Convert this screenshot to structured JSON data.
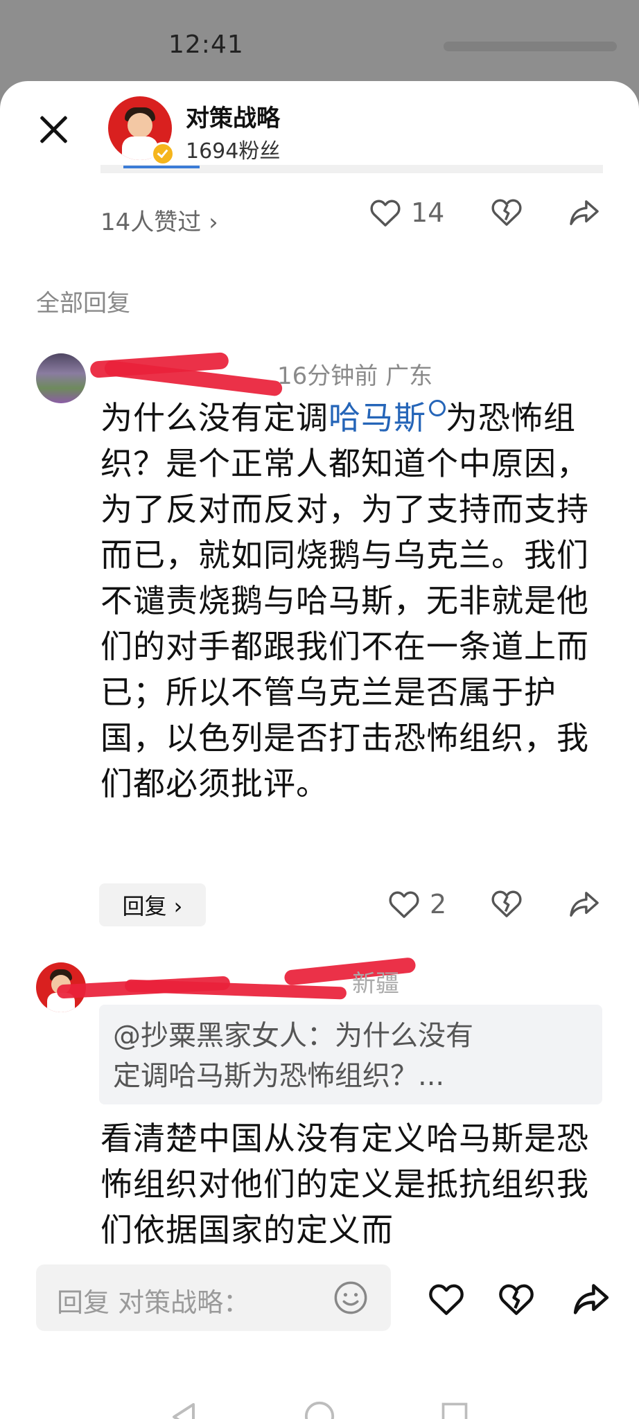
{
  "status_bar": {
    "time": "12:41"
  },
  "post_header": {
    "author_name": "对策战略",
    "fans": "1694粉丝"
  },
  "post_actions": {
    "likes_link": "14人赞过 ›",
    "like_count": "14"
  },
  "section_title": "全部回复",
  "comments": [
    {
      "meta_visible": "16分钟前 广东",
      "text_before": "为什么没有定调",
      "keyword": "哈马斯",
      "text_after": "为恐怖组织？是个正常人都知道个中原因，为了反对而反对，为了支持而支持而已，就如同烧鹅与乌克兰。我们不谴责烧鹅与哈马斯，无非就是他们的对手都跟我们不在一条道上而已；所以不管乌克兰是否属于护国，以色列是否打击恐怖组织，我们都必须批评。",
      "reply_label": "回复 ›",
      "like_count": "2"
    },
    {
      "meta_visible": "新疆",
      "quote_line1": "@抄粟黑家女人：为什么没有",
      "quote_line2": "定调哈马斯为恐怖组织？...",
      "text": "看清楚中国从没有定义哈马斯是恐怖组织对他们的定义是抵抗组织我们依据国家的定义而"
    }
  ],
  "reply_bar": {
    "placeholder": "回复 对策战略："
  },
  "colors": {
    "accent_blue": "#2565b8",
    "redact": "#e9213a",
    "avatar_red": "#d9201f"
  },
  "icons": [
    "close-icon",
    "heart-icon",
    "broken-heart-icon",
    "share-icon",
    "search-icon",
    "emoji-icon",
    "back-icon",
    "home-icon",
    "recents-icon"
  ]
}
